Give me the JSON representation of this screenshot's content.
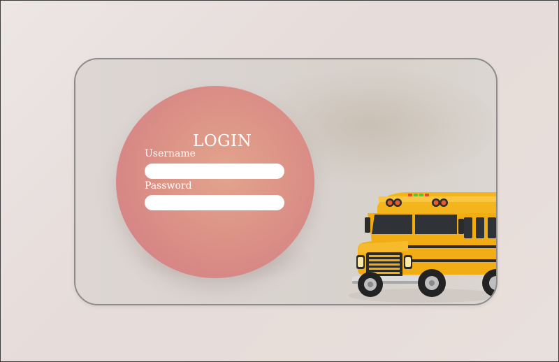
{
  "login_form": {
    "title": "LOGIN",
    "username_label": "Username",
    "username_value": "",
    "password_label": "Password",
    "password_value": ""
  },
  "colors": {
    "circle_accent": "#d98a86",
    "card_border": "#8c8c8c",
    "bus_yellow": "#f2b21b"
  },
  "icons": {
    "illustration": "school-bus-illustration"
  }
}
